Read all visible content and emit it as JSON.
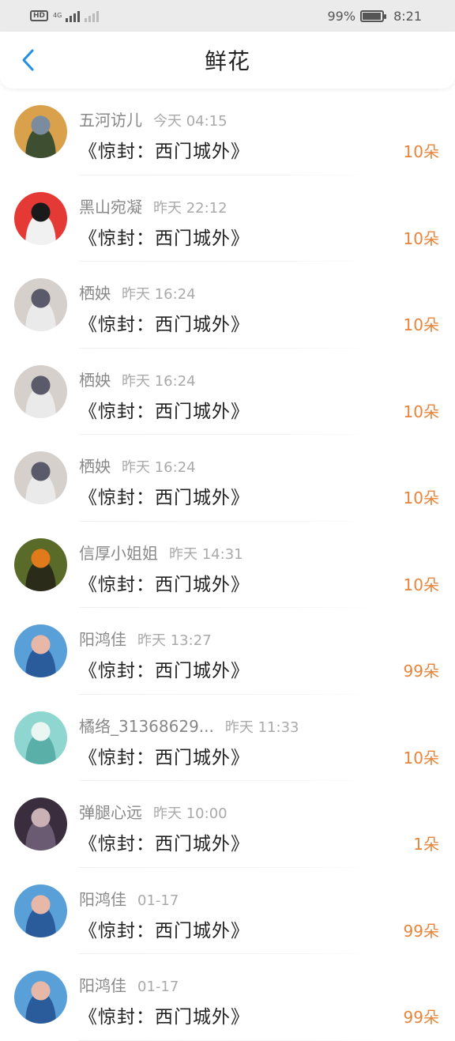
{
  "status_bar": {
    "hd": "HD",
    "net": "4G",
    "battery_pct": "99%",
    "time": "8:21"
  },
  "header": {
    "title": "鲜花",
    "back_icon": "chevron-left-icon",
    "accent": "#1e90e8"
  },
  "colors": {
    "count": "#e8843a"
  },
  "items": [
    {
      "name": "五河访儿",
      "time": "今天 04:15",
      "book": "《惊封：西门城外》",
      "count": "10朵",
      "avatar": [
        "#d9a14b",
        "#7a8c9e",
        "#3d4f30"
      ]
    },
    {
      "name": "黑山宛凝",
      "time": "昨天 22:12",
      "book": "《惊封：西门城外》",
      "count": "10朵",
      "avatar": [
        "#e53935",
        "#1a1a1a",
        "#f1f1f1"
      ]
    },
    {
      "name": "栖姎",
      "time": "昨天 16:24",
      "book": "《惊封：西门城外》",
      "count": "10朵",
      "avatar": [
        "#d6d0cc",
        "#5a5a6a",
        "#eaeaea"
      ]
    },
    {
      "name": "栖姎",
      "time": "昨天 16:24",
      "book": "《惊封：西门城外》",
      "count": "10朵",
      "avatar": [
        "#d6d0cc",
        "#5a5a6a",
        "#eaeaea"
      ]
    },
    {
      "name": "栖姎",
      "time": "昨天 16:24",
      "book": "《惊封：西门城外》",
      "count": "10朵",
      "avatar": [
        "#d6d0cc",
        "#5a5a6a",
        "#eaeaea"
      ]
    },
    {
      "name": "信厚小姐姐",
      "time": "昨天 14:31",
      "book": "《惊封：西门城外》",
      "count": "10朵",
      "avatar": [
        "#5a6a28",
        "#e07a1a",
        "#2b2b1a"
      ]
    },
    {
      "name": "阳鸿佳",
      "time": "昨天 13:27",
      "book": "《惊封：西门城外》",
      "count": "99朵",
      "avatar": [
        "#5aa0d8",
        "#e7b7a8",
        "#2a5c9c"
      ]
    },
    {
      "name": "橘络_31368629...",
      "time": "昨天 11:33",
      "book": "《惊封：西门城外》",
      "count": "10朵",
      "avatar": [
        "#8ed6cf",
        "#eaf6f2",
        "#5ab0a8"
      ]
    },
    {
      "name": "弹腿心远",
      "time": "昨天 10:00",
      "book": "《惊封：西门城外》",
      "count": "1朵",
      "avatar": [
        "#3a2e3e",
        "#c9b1b5",
        "#6a5a72"
      ]
    },
    {
      "name": "阳鸿佳",
      "time": "01-17",
      "book": "《惊封：西门城外》",
      "count": "99朵",
      "avatar": [
        "#5aa0d8",
        "#e7b7a8",
        "#2a5c9c"
      ]
    },
    {
      "name": "阳鸿佳",
      "time": "01-17",
      "book": "《惊封：西门城外》",
      "count": "99朵",
      "avatar": [
        "#5aa0d8",
        "#e7b7a8",
        "#2a5c9c"
      ]
    }
  ]
}
